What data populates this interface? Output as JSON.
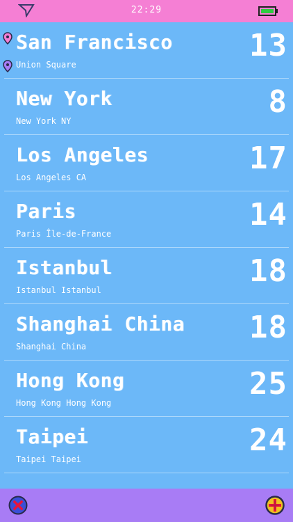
{
  "status_bar": {
    "time": "22:29",
    "icons": [
      "location-arrow-icon",
      "battery-icon"
    ],
    "battery_color": "#2ecc40"
  },
  "colors": {
    "background": "#6cb8f8",
    "status_bar": "#f57fd4",
    "bottom_bar": "#a87cf5"
  },
  "cities": [
    {
      "name": "San Francisco",
      "region": "Union Square",
      "temp": "13",
      "current_location": true
    },
    {
      "name": "New York",
      "region": "New York NY",
      "temp": "8"
    },
    {
      "name": "Los Angeles",
      "region": "Los Angeles CA",
      "temp": "17"
    },
    {
      "name": "Paris",
      "region": "Paris Île-de-France",
      "temp": "14"
    },
    {
      "name": "Istanbul",
      "region": "Istanbul Istanbul",
      "temp": "18"
    },
    {
      "name": "Shanghai China",
      "region": "Shanghai China",
      "temp": "18"
    },
    {
      "name": "Hong Kong",
      "region": "Hong Kong Hong Kong",
      "temp": "25"
    },
    {
      "name": "Taipei",
      "region": "Taipei Taipei",
      "temp": "24"
    }
  ],
  "bottom_bar": {
    "icons": [
      "remove-city-icon",
      "add-city-icon"
    ]
  }
}
